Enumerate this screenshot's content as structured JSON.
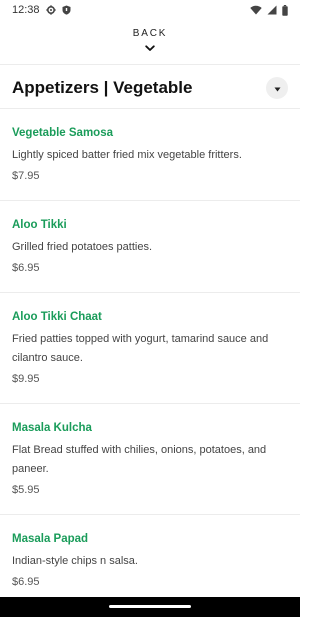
{
  "status_bar": {
    "time": "12:38",
    "icons": [
      "gear-icon",
      "shield-icon",
      "wifi-icon",
      "signal-icon",
      "battery-icon"
    ]
  },
  "nav": {
    "back_label": "BACK"
  },
  "header": {
    "title": "Appetizers | Vegetable"
  },
  "menu": {
    "items": [
      {
        "name": "Vegetable Samosa",
        "description": "Lightly spiced batter fried mix vegetable fritters.",
        "price": "$7.95"
      },
      {
        "name": "Aloo Tikki",
        "description": "Grilled fried potatoes patties.",
        "price": "$6.95"
      },
      {
        "name": "Aloo Tikki Chaat",
        "description": "Fried patties topped with yogurt, tamarind sauce and cilantro sauce.",
        "price": "$9.95"
      },
      {
        "name": "Masala Kulcha",
        "description": "Flat Bread stuffed with chilies, onions, potatoes, and paneer.",
        "price": "$5.95"
      },
      {
        "name": "Masala Papad",
        "description": "Indian-style chips n salsa.",
        "price": "$6.95"
      }
    ]
  },
  "colors": {
    "accent": "#1a9c5a",
    "system_bar": "#000000"
  }
}
